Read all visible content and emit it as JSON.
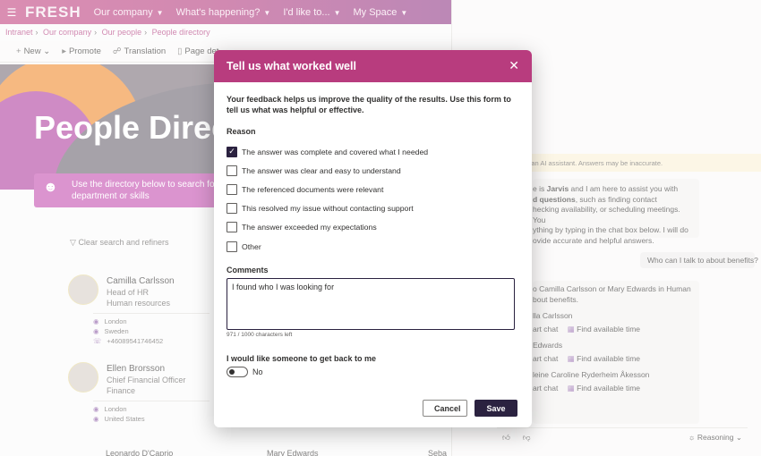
{
  "topnav": {
    "brand": "FRESH",
    "items": [
      {
        "label": "Our company"
      },
      {
        "label": "What's happening?"
      },
      {
        "label": "I'd like to..."
      },
      {
        "label": "My Space"
      }
    ]
  },
  "breadcrumb": [
    "Intranet",
    "Our company",
    "Our people",
    "People directory"
  ],
  "commandbar": {
    "new": "New",
    "promote": "Promote",
    "translation": "Translation",
    "page_details": "Page det"
  },
  "hero": {
    "title": "People Direc",
    "banner_line1": "Use the directory below to search for",
    "banner_line2": "department or skills"
  },
  "refiners": {
    "clear": "Clear search and refiners"
  },
  "people": [
    {
      "name": "Camilla Carlsson",
      "role": "Head of HR",
      "department": "Human resources",
      "city": "London",
      "country": "Sweden",
      "phone": "+46089541746452"
    },
    {
      "name": "Ellen Brorsson",
      "role": "Chief Financial Officer",
      "department": "Finance",
      "city": "London",
      "country": "United States"
    }
  ],
  "bottom_names": [
    "Leonardo D'Caprio",
    "Mary Edwards",
    "Seba"
  ],
  "chat": {
    "disclaimer": "th an AI assistant. Answers may be inaccurate.",
    "intro_l1": "e is ",
    "assistant_name": "Jarvis",
    "intro_l1b": " and I am here to assist you with",
    "intro_l2a": "d questions",
    "intro_l2b": ", such as finding contact",
    "intro_l3": "hecking availability, or scheduling meetings. You",
    "intro_l4": "ything by typing in the chat box below. I will do",
    "intro_l5": "ovide accurate and helpful answers.",
    "user_message": "Who can I talk to about benefits?",
    "answer_l1": "o Camilla Carlsson or Mary Edwards in Human",
    "answer_l2": "bout benefits.",
    "contact1": "lla Carlsson",
    "contact2": "Edwards",
    "contact3": "leine Caroline Ryderheim Åkesson",
    "start_chat": "art chat",
    "find_time": "Find available time",
    "reasoning": "Reasoning"
  },
  "dialog": {
    "title": "Tell us what worked well",
    "intro": "Your feedback helps us improve the quality of the results. Use this form to tell us what was helpful or effective.",
    "reason_label": "Reason",
    "reasons": [
      {
        "label": "The answer was complete and covered what I needed",
        "checked": true
      },
      {
        "label": "The answer was clear and easy to understand",
        "checked": false
      },
      {
        "label": "The referenced documents were relevant",
        "checked": false
      },
      {
        "label": "This resolved my issue without contacting support",
        "checked": false
      },
      {
        "label": "The answer exceeded my expectations",
        "checked": false
      },
      {
        "label": "Other",
        "checked": false
      }
    ],
    "comments_label": "Comments",
    "comments_value": "I found who I was looking for",
    "char_count": "971 / 1000 characters left",
    "getback_label": "I would like someone to get back to me",
    "toggle_value": "No",
    "cancel_label": "Cancel",
    "save_label": "Save"
  },
  "colors": {
    "brand": "#b83c7e",
    "primary_button": "#2b2240"
  }
}
